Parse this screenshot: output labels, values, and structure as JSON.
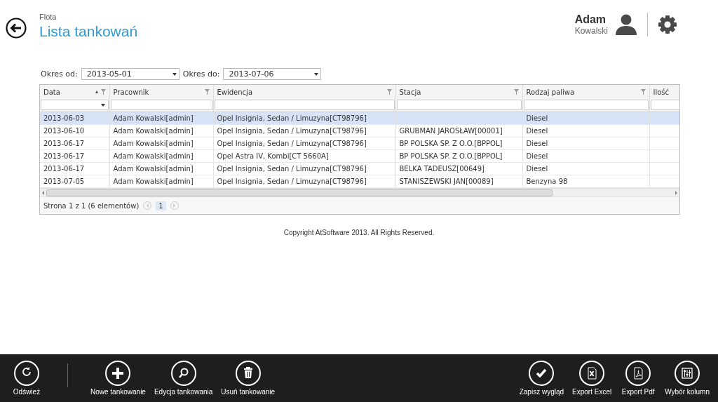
{
  "header": {
    "breadcrumb": "Flota",
    "title": "Lista tankowań",
    "user": {
      "first_name": "Adam",
      "last_name": "Kowalski"
    }
  },
  "filters": [
    {
      "label": "Okres od:",
      "value": "2013-05-01"
    },
    {
      "label": "Okres do:",
      "value": "2013-07-06"
    }
  ],
  "table": {
    "columns": [
      {
        "label": "Data",
        "sorted_ascending": true,
        "filter_icon": true,
        "kind": "dropdown"
      },
      {
        "label": "Pracownik",
        "sorted_ascending": false,
        "filter_icon": true,
        "kind": "text"
      },
      {
        "label": "Ewidencja",
        "sorted_ascending": false,
        "filter_icon": true,
        "kind": "text"
      },
      {
        "label": "Stacja",
        "sorted_ascending": false,
        "filter_icon": true,
        "kind": "text"
      },
      {
        "label": "Rodzaj paliwa",
        "sorted_ascending": false,
        "filter_icon": true,
        "kind": "text"
      },
      {
        "label": "Ilość",
        "sorted_ascending": false,
        "filter_icon": false,
        "kind": "text"
      }
    ],
    "rows": [
      {
        "selected": true,
        "cells": [
          "2013-06-03",
          "Adam Kowalski[admin]",
          "Opel Insignia, Sedan / Limuzyna[CT98796]",
          null,
          "Diesel"
        ]
      },
      {
        "selected": false,
        "cells": [
          "2013-06-10",
          "Adam Kowalski[admin]",
          "Opel Insignia, Sedan / Limuzyna[CT98796]",
          "GRUBMAN JAROSŁAW[00001]",
          "Diesel"
        ]
      },
      {
        "selected": false,
        "cells": [
          "2013-06-17",
          "Adam Kowalski[admin]",
          "Opel Insignia, Sedan / Limuzyna[CT98796]",
          "BP POLSKA SP. Z O.O.[BPPOL]",
          "Diesel"
        ]
      },
      {
        "selected": false,
        "cells": [
          "2013-06-17",
          "Adam Kowalski[admin]",
          "Opel Astra IV, Kombi[CT 5660A]",
          "BP POLSKA SP. Z O.O.[BPPOL]",
          "Diesel"
        ]
      },
      {
        "selected": false,
        "cells": [
          "2013-06-17",
          "Adam Kowalski[admin]",
          "Opel Insignia, Sedan / Limuzyna[CT98796]",
          "BELKA TADEUSZ[00649]",
          "Diesel"
        ]
      },
      {
        "selected": false,
        "cells": [
          "2013-07-05",
          "Adam Kowalski[admin]",
          "Opel Insignia, Sedan / Limuzyna[CT98796]",
          "STANISZEWSKI JAN[00089]",
          "Benzyna 98"
        ]
      }
    ],
    "pager": {
      "summary": "Strona 1 z 1 (6 elementów)",
      "pages": [
        {
          "label": "1",
          "selected": true
        }
      ]
    }
  },
  "copyright": "Copyright AtSoftware 2013. All Rights Reserved.",
  "app_bar": {
    "left": [
      {
        "label": "Odśwież",
        "kind": "refresh"
      }
    ],
    "middle": [
      {
        "label": "Nowe tankowanie",
        "kind": "plus"
      },
      {
        "label": "Edycja tankowania",
        "kind": "search"
      },
      {
        "label": "Usuń tankowanie",
        "kind": "trash"
      }
    ],
    "right": [
      {
        "label": "Zapisz wygląd",
        "kind": "check"
      },
      {
        "label": "Export Excel",
        "kind": "excel"
      },
      {
        "label": "Export Pdf",
        "kind": "pdf"
      },
      {
        "label": "Wybór kolumn",
        "kind": "sliders"
      }
    ]
  }
}
